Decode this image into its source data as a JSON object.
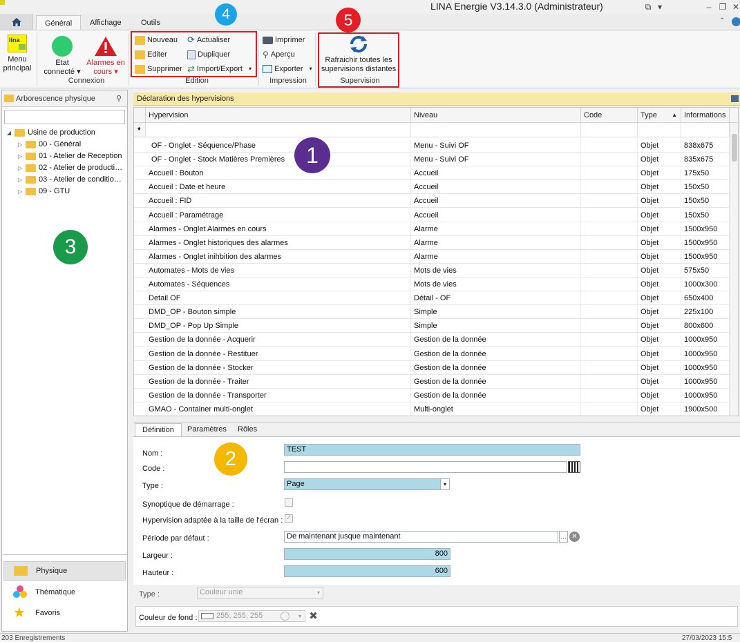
{
  "window": {
    "title": "LINA Energie  V3.14.3.0  (Administrateur)"
  },
  "ribbon_tabs": [
    "Général",
    "Affichage",
    "Outils"
  ],
  "ribbon": {
    "menu_principal": [
      "Menu",
      "principal"
    ],
    "connexion": {
      "etat": [
        "Etat",
        "connecté ▾"
      ],
      "alarmes": [
        "Alarmes en",
        "cours ▾"
      ],
      "label": "Connexion"
    },
    "edition": {
      "nouveau": "Nouveau",
      "editer": "Editer",
      "supprimer": "Supprimer",
      "actualiser": "Actualiser",
      "dupliquer": "Dupliquer",
      "import_export": "Import/Export",
      "label": "Edition"
    },
    "impression": {
      "imprimer": "Imprimer",
      "apercu": "Aperçu",
      "exporter": "Exporter",
      "label": "Impression"
    },
    "supervision": {
      "refresh": [
        "Rafraichir toutes les",
        "supervisions distantes"
      ],
      "label": "Supervision"
    }
  },
  "badges": [
    "1",
    "2",
    "3",
    "4",
    "5"
  ],
  "left_panel": {
    "header": "Arborescence physique",
    "search_value": "",
    "tree_root": "Usine de production",
    "tree_children": [
      "00 - Général",
      "01 - Atelier de Reception",
      "02 - Atelier de producti…",
      "03 - Atelier de conditio…",
      "09 - GTU"
    ],
    "nav": [
      "Physique",
      "Thématique",
      "Favoris"
    ]
  },
  "main_panel": {
    "header": "Déclaration des hypervisions",
    "columns": [
      "Hypervision",
      "Niveau",
      "Code",
      "Type",
      "Informations"
    ],
    "rows": [
      [
        "OF - Onglet - Séquence/Phase",
        "Menu - Suivi OF",
        "",
        "Objet",
        "838x675"
      ],
      [
        "OF - Onglet - Stock Matières Premières",
        "Menu - Suivi OF",
        "",
        "Objet",
        "835x675"
      ],
      [
        "Accueil  : Bouton",
        "Accueil",
        "",
        "Objet",
        "175x50"
      ],
      [
        "Accueil : Date et heure",
        "Accueil",
        "",
        "Objet",
        "150x50"
      ],
      [
        "Accueil : FID",
        "Accueil",
        "",
        "Objet",
        "150x50"
      ],
      [
        "Accueil : Paramétrage",
        "Accueil",
        "",
        "Objet",
        "150x50"
      ],
      [
        "Alarmes - Onglet Alarmes en cours",
        "Alarme",
        "",
        "Objet",
        "1500x950"
      ],
      [
        "Alarmes - Onglet historiques des alarmes",
        "Alarme",
        "",
        "Objet",
        "1500x950"
      ],
      [
        "Alarmes - Onglet inihbition des alarmes",
        "Alarme",
        "",
        "Objet",
        "1500x950"
      ],
      [
        "Automates - Mots de vies",
        "Mots de vies",
        "",
        "Objet",
        "575x50"
      ],
      [
        "Automates - Séquences",
        "Mots de vies",
        "",
        "Objet",
        "1000x300"
      ],
      [
        "Detail OF",
        "Détail - OF",
        "",
        "Objet",
        "650x400"
      ],
      [
        "DMD_OP - Bouton simple",
        "Simple",
        "",
        "Objet",
        "225x100"
      ],
      [
        "DMD_OP - Pop Up Simple",
        "Simple",
        "",
        "Objet",
        "800x600"
      ],
      [
        "Gestion de la donnée - Acquerir",
        "Gestion de la donnée",
        "",
        "Objet",
        "1000x950"
      ],
      [
        "Gestion de la donnée - Restituer",
        "Gestion de la donnée",
        "",
        "Objet",
        "1000x950"
      ],
      [
        "Gestion de la donnée - Stocker",
        "Gestion de la donnée",
        "",
        "Objet",
        "1000x950"
      ],
      [
        "Gestion de la donnée - Traiter",
        "Gestion de la donnée",
        "",
        "Objet",
        "1000x950"
      ],
      [
        "Gestion de la donnée - Transporter",
        "Gestion de la donnée",
        "",
        "Objet",
        "1000x950"
      ],
      [
        "GMAO - Container multi-onglet",
        "Multi-onglet",
        "",
        "Objet",
        "1900x500"
      ]
    ]
  },
  "detail": {
    "tabs": [
      "Définition",
      "Paramètres",
      "Rôles"
    ],
    "labels": {
      "nom": "Nom :",
      "code": "Code :",
      "type": "Type :",
      "synoptique": "Synoptique de démarrage :",
      "adaptee": "Hypervision adaptée à la taille de l'écran :",
      "periode": "Période par défaut :",
      "largeur": "Largeur :",
      "hauteur": "Hauteur :",
      "type2": "Type :",
      "couleur": "Couleur de fond :"
    },
    "values": {
      "nom": "TEST",
      "code": "",
      "type": "Page",
      "periode": "De maintenant jusque maintenant",
      "largeur": "800",
      "hauteur": "600",
      "type2": "Couleur unie",
      "couleur": "255; 255; 255"
    },
    "synoptique_checked": false,
    "adaptee_checked": true
  },
  "status": {
    "left": "203 Enregistrements",
    "right": "27/03/2023 15:5"
  },
  "colors": {
    "accent_red": "#d51f26",
    "badge_purple": "#5b2d8e",
    "badge_yellow": "#f5b800",
    "badge_green": "#1a9b4b",
    "badge_blue": "#1aa3e6",
    "badge_red": "#e41e26",
    "field_blue": "#add8e6"
  }
}
